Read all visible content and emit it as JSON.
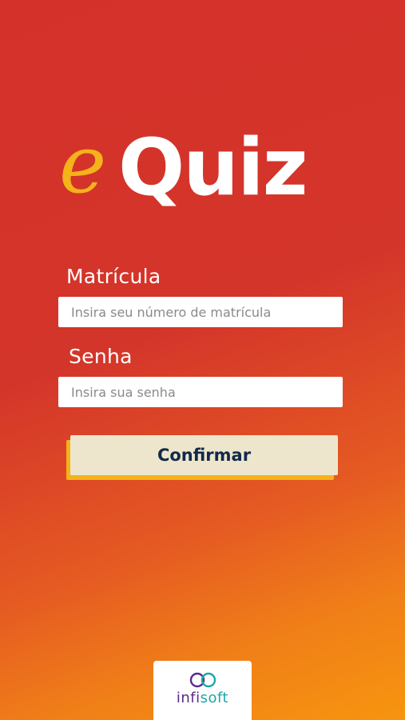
{
  "logo": {
    "prefix": "e",
    "word": "Quiz"
  },
  "form": {
    "matricula_label": "Matrícula",
    "matricula_placeholder": "Insira seu número de matrícula",
    "senha_label": "Senha",
    "senha_placeholder": "Insira sua senha",
    "confirm_label": "Confirmar"
  },
  "brand": {
    "part1": "infi",
    "part2": "soft"
  },
  "colors": {
    "background_top": "#d4312b",
    "background_bottom": "#f7950f",
    "logo_e": "#f4b31a",
    "button_bg": "#ede6cc",
    "button_shadow": "#f4b31a",
    "button_text": "#13294b",
    "brand_purple": "#5a2b8a",
    "brand_teal": "#1ea7a6"
  }
}
